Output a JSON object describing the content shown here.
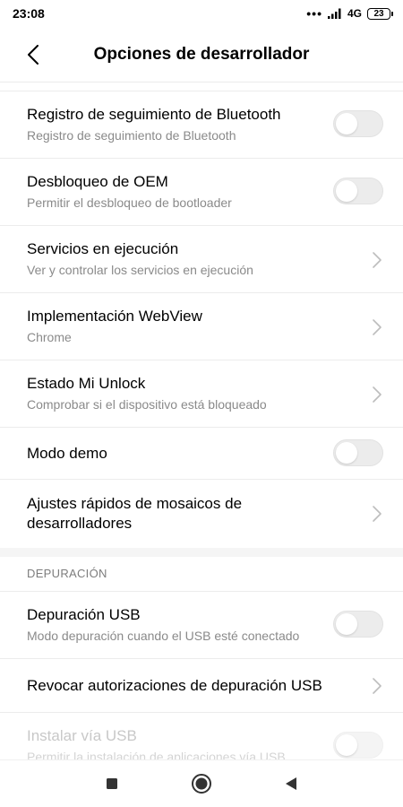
{
  "status_bar": {
    "time": "23:08",
    "dots": "•••",
    "signal_icon": "signal-bars-icon",
    "network": "4G",
    "battery": "23"
  },
  "header": {
    "back_icon": "chevron-left-icon",
    "title": "Opciones de desarrollador"
  },
  "items": [
    {
      "title": "Registro de seguimiento de Bluetooth",
      "subtitle": "Registro de seguimiento de Bluetooth",
      "control": "toggle",
      "on": false
    },
    {
      "title": "Desbloqueo de OEM",
      "subtitle": "Permitir el desbloqueo de bootloader",
      "control": "toggle",
      "on": false
    },
    {
      "title": "Servicios en ejecución",
      "subtitle": "Ver y controlar los servicios en ejecución",
      "control": "chevron"
    },
    {
      "title": "Implementación WebView",
      "subtitle": "Chrome",
      "control": "chevron"
    },
    {
      "title": "Estado Mi Unlock",
      "subtitle": "Comprobar si el dispositivo está bloqueado",
      "control": "chevron"
    },
    {
      "title": "Modo demo",
      "subtitle": "",
      "control": "toggle",
      "on": false
    },
    {
      "title_line1": "Ajustes rápidos de mosaicos de",
      "title_line2": "desarrolladores",
      "control": "chevron"
    }
  ],
  "section": {
    "header": "DEPURACIÓN"
  },
  "debug_items": [
    {
      "title": "Depuración USB",
      "subtitle": "Modo depuración cuando el USB esté conectado",
      "control": "toggle",
      "on": false
    },
    {
      "title": "Revocar autorizaciones de depuración USB",
      "control": "chevron"
    },
    {
      "title": "Instalar vía USB",
      "subtitle": "Permitir la instalación de aplicaciones vía USB",
      "control": "toggle",
      "on": false,
      "disabled": true
    }
  ],
  "nav_bar": {
    "recents_icon": "square-icon",
    "home_icon": "circle-home-icon",
    "back_icon": "triangle-back-icon"
  },
  "colors": {
    "text_primary": "#000000",
    "text_secondary": "#8a8a8a",
    "divider": "#ececec",
    "toggle_off": "#ececec",
    "chevron": "#bdbdbd"
  }
}
